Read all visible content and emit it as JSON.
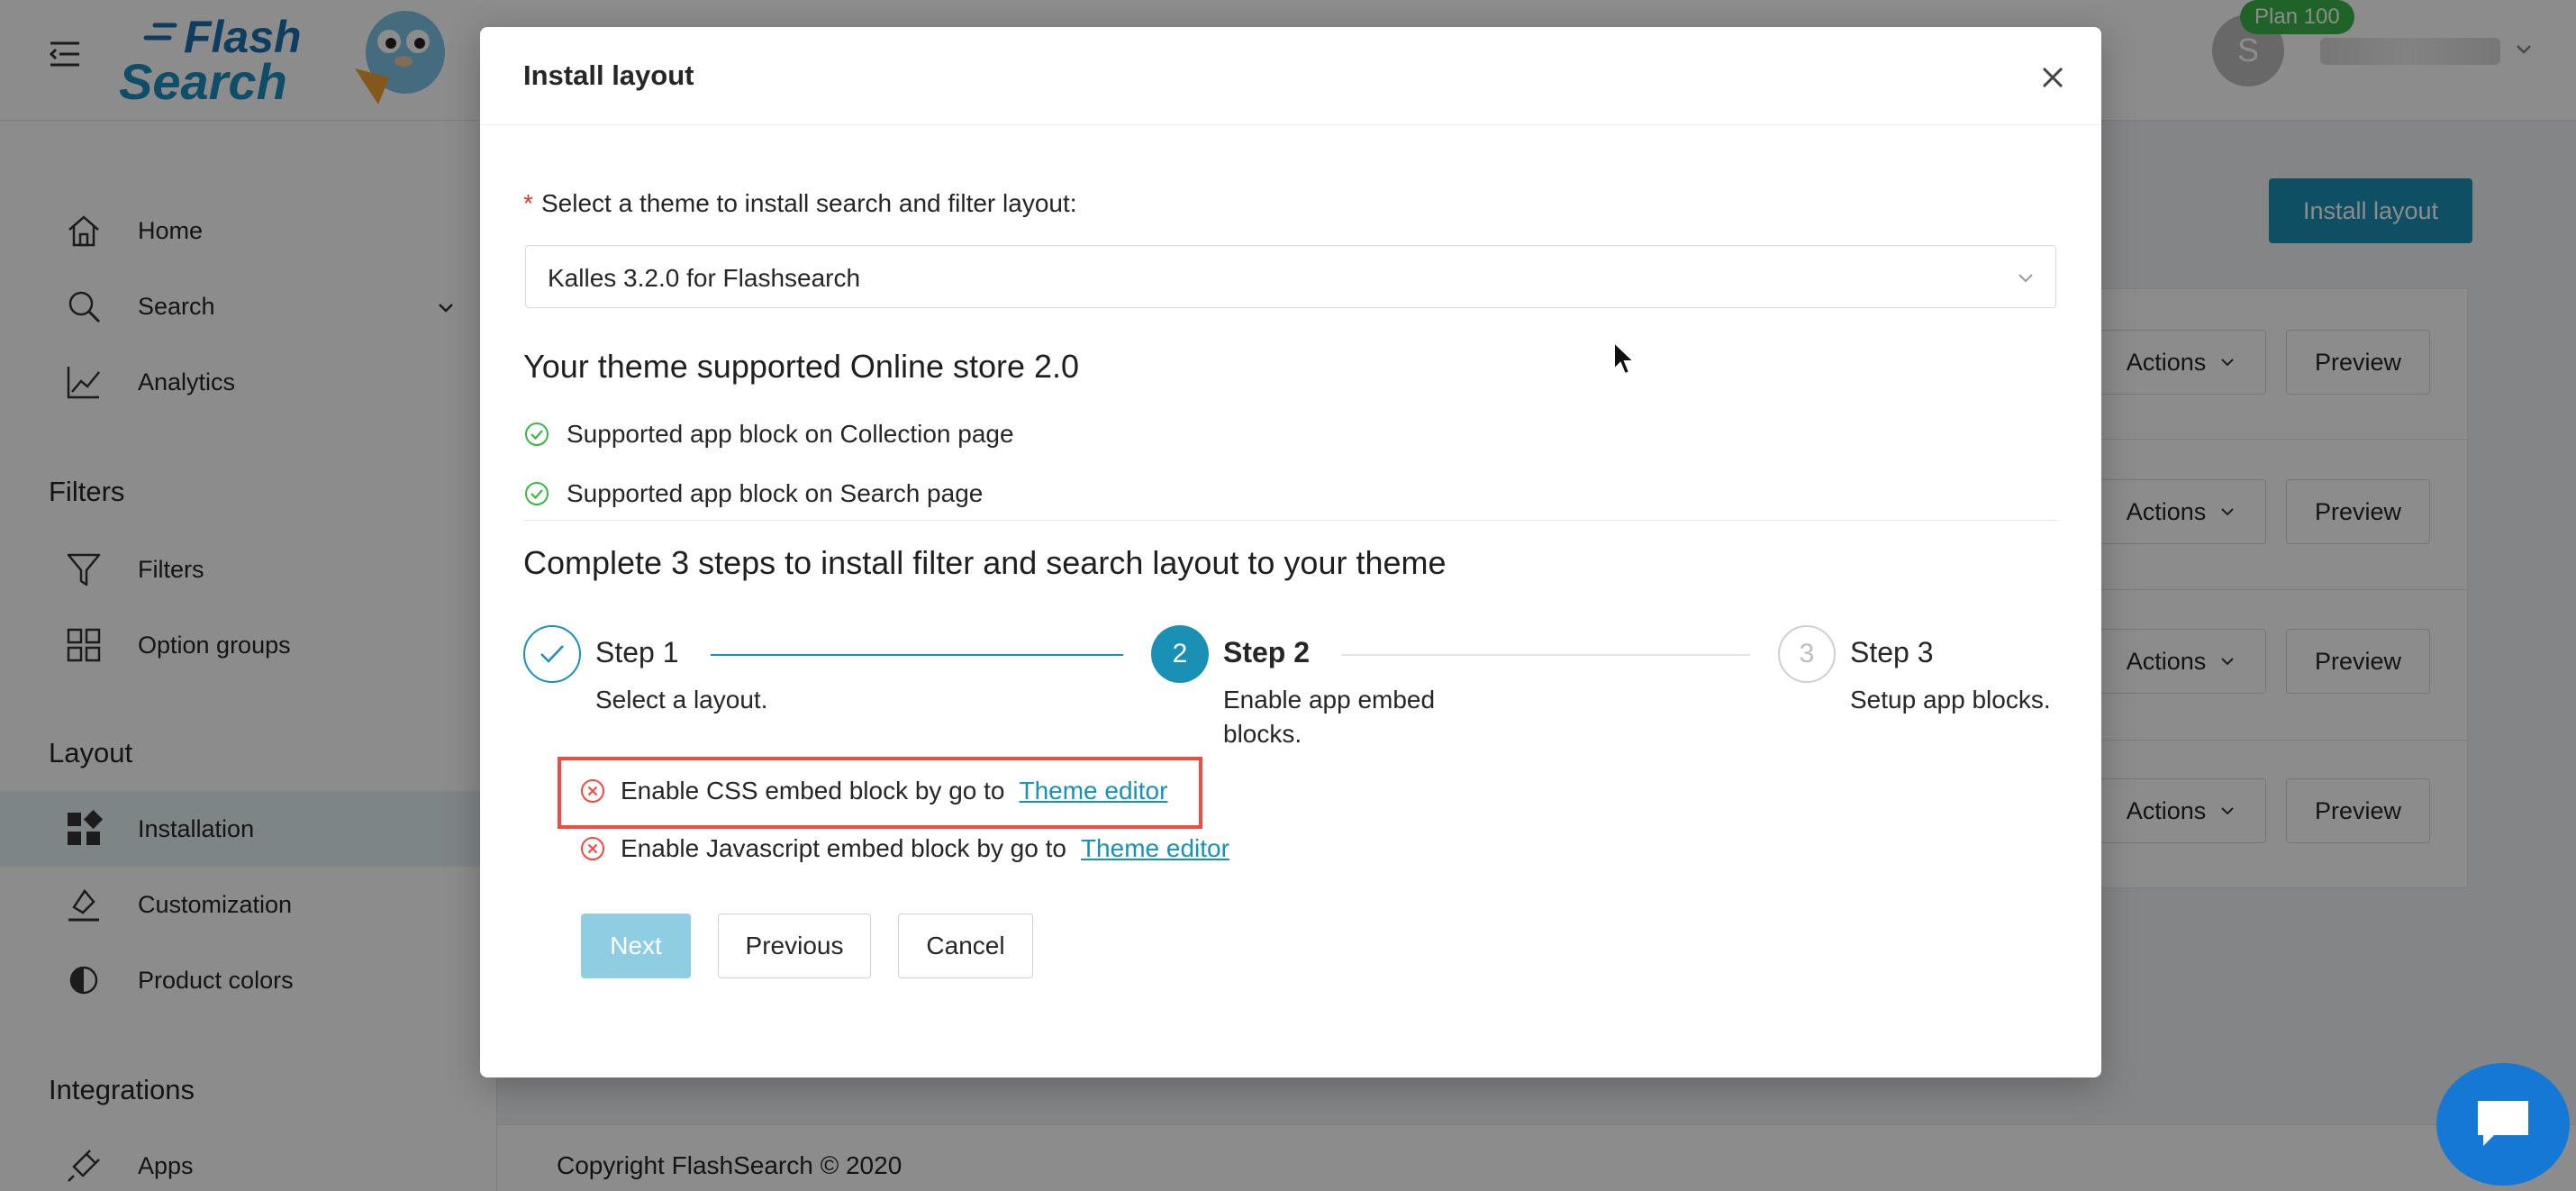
{
  "header": {
    "logo_line1": "Flash",
    "logo_line2": "Search",
    "avatar_initial": "S",
    "plan_badge": "Plan 100"
  },
  "sidebar": {
    "items": [
      {
        "label": "Home",
        "icon": "home-icon"
      },
      {
        "label": "Search",
        "icon": "search-icon"
      },
      {
        "label": "Analytics",
        "icon": "analytics-icon"
      },
      {
        "label": "Filters",
        "icon": "filter-icon"
      },
      {
        "label": "Option groups",
        "icon": "option-groups-icon"
      },
      {
        "label": "Installation",
        "icon": "installation-icon"
      },
      {
        "label": "Customization",
        "icon": "customization-icon"
      },
      {
        "label": "Product colors",
        "icon": "product-colors-icon"
      },
      {
        "label": "Apps",
        "icon": "apps-icon"
      }
    ],
    "sections": [
      "Filters",
      "Layout",
      "Integrations"
    ]
  },
  "main": {
    "install_button": "Install layout",
    "actions_label": "Actions",
    "preview_label": "Preview",
    "copyright": "Copyright FlashSearch © 2020"
  },
  "modal": {
    "title": "Install layout",
    "required_marker": "*",
    "select_label": "Select a theme to install search and filter layout:",
    "selected_theme": "Kalles 3.2.0 for Flashsearch",
    "support_title": "Your theme supported Online store 2.0",
    "support_items": [
      "Supported app block on Collection page",
      "Supported app block on Search page"
    ],
    "steps_title": "Complete 3 steps to install filter and search layout to your theme",
    "steps": [
      {
        "number": "",
        "title": "Step 1",
        "desc": "Select a layout.",
        "status": "done"
      },
      {
        "number": "2",
        "title": "Step 2",
        "desc_line1": "Enable app embed",
        "desc_line2": "blocks.",
        "status": "current"
      },
      {
        "number": "3",
        "title": "Step 3",
        "desc": "Setup app blocks.",
        "status": "pending"
      }
    ],
    "errors": [
      {
        "text": "Enable CSS embed block by go to",
        "link": "Theme editor"
      },
      {
        "text": "Enable Javascript embed block by go to",
        "link": "Theme editor"
      }
    ],
    "buttons": {
      "next": "Next",
      "previous": "Previous",
      "cancel": "Cancel"
    }
  },
  "colors": {
    "primary": "#1a90b4",
    "success": "#3bb44a",
    "error": "#f04a43",
    "next_disabled": "#8fcde3",
    "chat": "#1478d4"
  }
}
